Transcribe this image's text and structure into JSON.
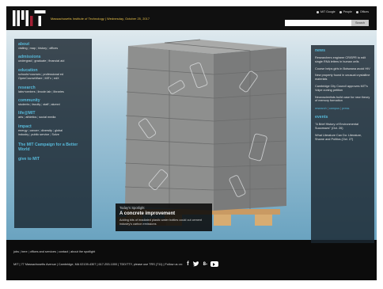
{
  "header": {
    "tagline": "Massachusetts Institute of Technology  |  Wednesday, October 25, 2017",
    "links": [
      "MIT Google",
      "People",
      "Offices"
    ],
    "search": {
      "placeholder": "",
      "button": "Search"
    }
  },
  "left_nav": {
    "sections": [
      {
        "heading": "about",
        "links": [
          "visiting",
          "map",
          "history",
          "offices"
        ]
      },
      {
        "heading": "admissions",
        "links": [
          "undergrad",
          "graduate",
          "financial aid"
        ]
      },
      {
        "heading": "education",
        "links": [
          "schools+courses",
          "professional ed",
          "OpenCourseWare",
          "MITx",
          "edX"
        ]
      },
      {
        "heading": "research",
        "links": [
          "labs+centers",
          "lincoln lab",
          "libraries"
        ]
      },
      {
        "heading": "community",
        "links": [
          "students",
          "faculty",
          "staff",
          "alumni"
        ]
      },
      {
        "heading": "life@MIT",
        "links": [
          "arts",
          "athletics",
          "social media"
        ]
      },
      {
        "heading": "impact",
        "links": [
          "energy",
          "cancer",
          "diversity",
          "global",
          "industry",
          "public service",
          "Solve"
        ]
      }
    ],
    "campaign": "The MIT Campaign for a Better World",
    "give": "give to MIT"
  },
  "right_nav": {
    "news_heading": "news",
    "news": [
      "Researchers engineer CRISPR to edit single RNA letters in human cells",
      "Course helps girls in Botswana avoid HIV",
      "New property found in unusual crystalline materials",
      "Cambridge City Council approves MIT's Volpe zoning petition",
      "Neuroscientists build case for new theory of memory formation"
    ],
    "news_links": [
      "research",
      "campus",
      "press"
    ],
    "events_heading": "events",
    "events": [
      "\"A Brief History of Environmental Successes\" (Oct. 26)",
      "What Literature Can Do: Literature, Shame and Politics (Oct. 27)"
    ]
  },
  "spotlight": {
    "kicker": "Today's Spotlight",
    "title": "A concrete improvement",
    "text": "Adding bits of irradiated plastic water bottles could cut cement industry's carbon emissions"
  },
  "footer": {
    "links": [
      "jobs",
      "here",
      "offices and services",
      "contact",
      "about the spotlight"
    ],
    "info": "MIT  |  77 Massachusetts Avenue  |  Cambridge, MA 02139-4307  |  617-253-1000  |  TDD/TTY, please use TRS (711)  |  Follow us on:",
    "social_icons": [
      "facebook-icon",
      "twitter-icon",
      "google-plus-icon",
      "youtube-icon"
    ]
  },
  "colors": {
    "accent_blue": "#57b8d8",
    "tagline_yellow": "#f2c94c",
    "panel": "#1a2630",
    "background": "#0c0c0c"
  }
}
